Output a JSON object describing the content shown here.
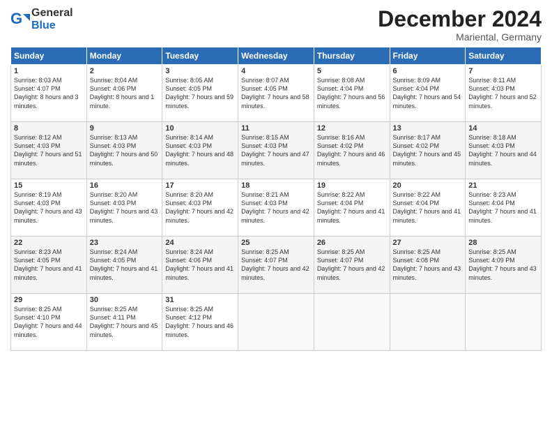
{
  "logo": {
    "general": "General",
    "blue": "Blue"
  },
  "title": "December 2024",
  "location": "Mariental, Germany",
  "days_header": [
    "Sunday",
    "Monday",
    "Tuesday",
    "Wednesday",
    "Thursday",
    "Friday",
    "Saturday"
  ],
  "weeks": [
    [
      {
        "day": 1,
        "sunrise": "8:03 AM",
        "sunset": "4:07 PM",
        "daylight": "8 hours and 3 minutes."
      },
      {
        "day": 2,
        "sunrise": "8:04 AM",
        "sunset": "4:06 PM",
        "daylight": "8 hours and 1 minute."
      },
      {
        "day": 3,
        "sunrise": "8:05 AM",
        "sunset": "4:05 PM",
        "daylight": "7 hours and 59 minutes."
      },
      {
        "day": 4,
        "sunrise": "8:07 AM",
        "sunset": "4:05 PM",
        "daylight": "7 hours and 58 minutes."
      },
      {
        "day": 5,
        "sunrise": "8:08 AM",
        "sunset": "4:04 PM",
        "daylight": "7 hours and 56 minutes."
      },
      {
        "day": 6,
        "sunrise": "8:09 AM",
        "sunset": "4:04 PM",
        "daylight": "7 hours and 54 minutes."
      },
      {
        "day": 7,
        "sunrise": "8:11 AM",
        "sunset": "4:03 PM",
        "daylight": "7 hours and 52 minutes."
      }
    ],
    [
      {
        "day": 8,
        "sunrise": "8:12 AM",
        "sunset": "4:03 PM",
        "daylight": "7 hours and 51 minutes."
      },
      {
        "day": 9,
        "sunrise": "8:13 AM",
        "sunset": "4:03 PM",
        "daylight": "7 hours and 50 minutes."
      },
      {
        "day": 10,
        "sunrise": "8:14 AM",
        "sunset": "4:03 PM",
        "daylight": "7 hours and 48 minutes."
      },
      {
        "day": 11,
        "sunrise": "8:15 AM",
        "sunset": "4:03 PM",
        "daylight": "7 hours and 47 minutes."
      },
      {
        "day": 12,
        "sunrise": "8:16 AM",
        "sunset": "4:02 PM",
        "daylight": "7 hours and 46 minutes."
      },
      {
        "day": 13,
        "sunrise": "8:17 AM",
        "sunset": "4:02 PM",
        "daylight": "7 hours and 45 minutes."
      },
      {
        "day": 14,
        "sunrise": "8:18 AM",
        "sunset": "4:03 PM",
        "daylight": "7 hours and 44 minutes."
      }
    ],
    [
      {
        "day": 15,
        "sunrise": "8:19 AM",
        "sunset": "4:03 PM",
        "daylight": "7 hours and 43 minutes."
      },
      {
        "day": 16,
        "sunrise": "8:20 AM",
        "sunset": "4:03 PM",
        "daylight": "7 hours and 43 minutes."
      },
      {
        "day": 17,
        "sunrise": "8:20 AM",
        "sunset": "4:03 PM",
        "daylight": "7 hours and 42 minutes."
      },
      {
        "day": 18,
        "sunrise": "8:21 AM",
        "sunset": "4:03 PM",
        "daylight": "7 hours and 42 minutes."
      },
      {
        "day": 19,
        "sunrise": "8:22 AM",
        "sunset": "4:04 PM",
        "daylight": "7 hours and 41 minutes."
      },
      {
        "day": 20,
        "sunrise": "8:22 AM",
        "sunset": "4:04 PM",
        "daylight": "7 hours and 41 minutes."
      },
      {
        "day": 21,
        "sunrise": "8:23 AM",
        "sunset": "4:04 PM",
        "daylight": "7 hours and 41 minutes."
      }
    ],
    [
      {
        "day": 22,
        "sunrise": "8:23 AM",
        "sunset": "4:05 PM",
        "daylight": "7 hours and 41 minutes."
      },
      {
        "day": 23,
        "sunrise": "8:24 AM",
        "sunset": "4:05 PM",
        "daylight": "7 hours and 41 minutes."
      },
      {
        "day": 24,
        "sunrise": "8:24 AM",
        "sunset": "4:06 PM",
        "daylight": "7 hours and 41 minutes."
      },
      {
        "day": 25,
        "sunrise": "8:25 AM",
        "sunset": "4:07 PM",
        "daylight": "7 hours and 42 minutes."
      },
      {
        "day": 26,
        "sunrise": "8:25 AM",
        "sunset": "4:07 PM",
        "daylight": "7 hours and 42 minutes."
      },
      {
        "day": 27,
        "sunrise": "8:25 AM",
        "sunset": "4:08 PM",
        "daylight": "7 hours and 43 minutes."
      },
      {
        "day": 28,
        "sunrise": "8:25 AM",
        "sunset": "4:09 PM",
        "daylight": "7 hours and 43 minutes."
      }
    ],
    [
      {
        "day": 29,
        "sunrise": "8:25 AM",
        "sunset": "4:10 PM",
        "daylight": "7 hours and 44 minutes."
      },
      {
        "day": 30,
        "sunrise": "8:25 AM",
        "sunset": "4:11 PM",
        "daylight": "7 hours and 45 minutes."
      },
      {
        "day": 31,
        "sunrise": "8:25 AM",
        "sunset": "4:12 PM",
        "daylight": "7 hours and 46 minutes."
      },
      null,
      null,
      null,
      null
    ]
  ]
}
